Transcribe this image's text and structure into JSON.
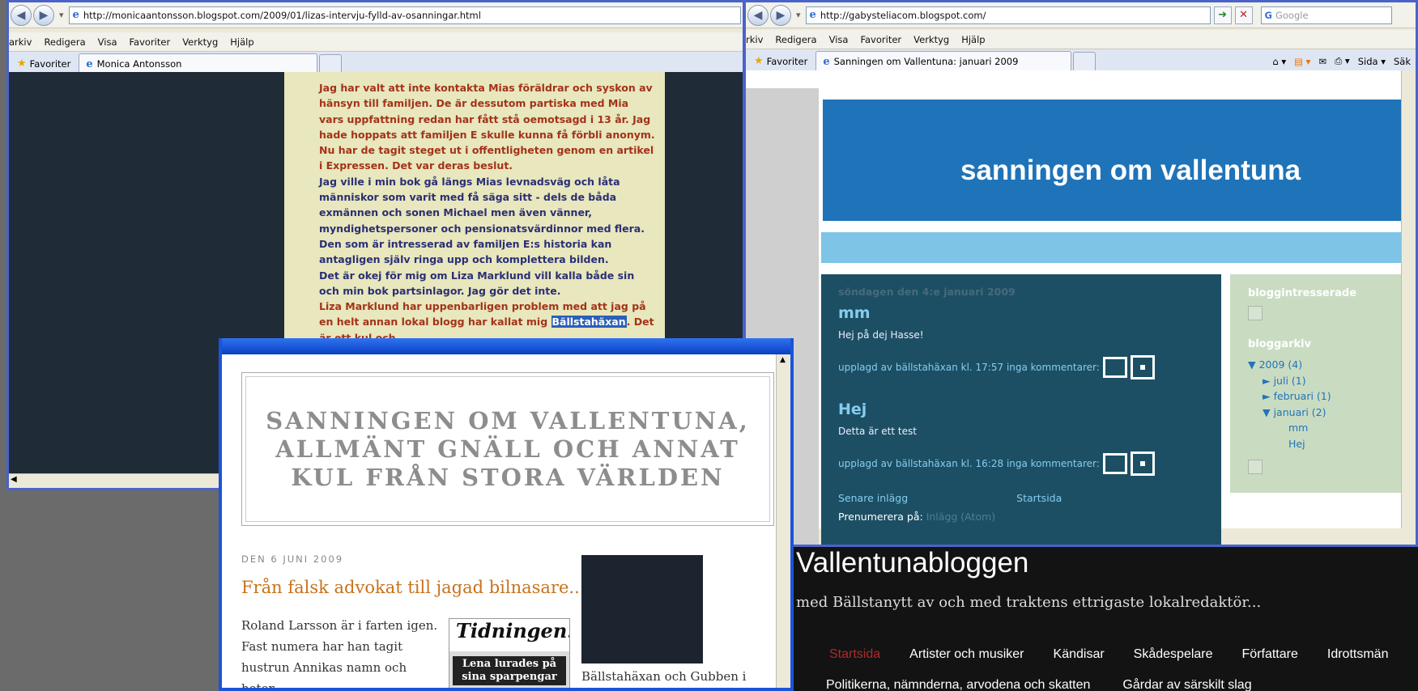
{
  "left_window": {
    "url": "http://monicaantonsson.blogspot.com/2009/01/lizas-intervju-fylld-av-osanningar.html",
    "menu": [
      "arkiv",
      "Redigera",
      "Visa",
      "Favoriter",
      "Verktyg",
      "Hjälp"
    ],
    "favorites_label": "Favoriter",
    "tab_title": "Monica Antonsson",
    "paragraphs": [
      {
        "color": "red",
        "text": "Jag har valt att inte kontakta Mias föräldrar och syskon av hänsyn till familjen. De är dessutom partiska med Mia vars uppfattning redan har fått stå oemotsagd i 13 år. Jag hade hoppats att familjen E skulle kunna få förbli anonym. Nu har de tagit steget ut i offentligheten genom en artikel i Expressen. Det var deras beslut."
      },
      {
        "color": "blue",
        "text": "Jag ville i min bok gå längs Mias levnadsväg och låta människor som varit med få säga sitt - dels de båda exmännen och sonen Michael men även vänner, myndighetspersoner och pensionatsvärdinnor med flera. Den som är intresserad av familjen E:s historia kan antagligen själv ringa upp och komplettera bilden."
      },
      {
        "color": "blue",
        "text": "Det är okej för mig om Liza Marklund vill kalla både sin och min bok partsinlagor. Jag gör det inte."
      }
    ],
    "last_para": {
      "before": "Liza Marklund har uppenbarligen problem med att jag på en helt annan lokal blogg har kallat mig ",
      "highlight": "Bällstahäxan",
      "after": ". Det är ett kul och"
    }
  },
  "right_window": {
    "url": "http://gabysteliacom.blogspot.com/",
    "search_placeholder": "Google",
    "menu": [
      "rkiv",
      "Redigera",
      "Visa",
      "Favoriter",
      "Verktyg",
      "Hjälp"
    ],
    "favorites_label": "Favoriter",
    "tab_title": "Sanningen om Vallentuna: januari 2009",
    "toolbar_page": "Sida",
    "toolbar_extra": "Säk",
    "banner_title": "sanningen om vallentuna",
    "post_date": "söndagen den 4:e januari 2009",
    "posts": [
      {
        "title": "mm",
        "body": "Hej på dej Hasse!",
        "footer": "upplagd av bällstahäxan kl. 17:57 inga kommentarer:"
      },
      {
        "title": "Hej",
        "body": "Detta är ett test",
        "footer": "upplagd av bällstahäxan kl. 16:28 inga kommentarer:"
      }
    ],
    "newer_link": "Senare inlägg",
    "home_link": "Startsida",
    "subscribe_label": "Prenumerera på:",
    "subscribe_link": "Inlägg (Atom)",
    "sidebar": {
      "heading1": "bloggintresserade",
      "heading2": "bloggarkiv",
      "tree": [
        "▼ 2009 (4)",
        "► juli (1)",
        "► februari (1)",
        "▼ januari (2)",
        "mm",
        "Hej"
      ]
    }
  },
  "popup_window": {
    "header": "SANNINGEN OM VALLENTUNA, ALLMÄNT GNÄLL OCH ANNAT KUL FRÅN STORA VÄRLDEN",
    "date": "DEN 6 JUNI 2009",
    "post_title": "Från falsk advokat till jagad bilnasare...",
    "text": "Roland Larsson är i farten igen. Fast numera har han tagit hustrun Annikas namn och heter",
    "paper_masthead": "Tidningen!",
    "paper_headline": "Lena lurades på sina sparpengar",
    "thumb_caption": "Bällstahäxan och Gubben i Hörnan"
  },
  "dark_window": {
    "title": "Vallentunabloggen",
    "subtitle": "med Bällstanytt av och med traktens ettrigaste lokalredaktör...",
    "nav1": [
      "Startsida",
      "Artister och musiker",
      "Kändisar",
      "Skådespelare",
      "Författare",
      "Idrottsmän"
    ],
    "nav2": [
      "Politikerna, nämnderna, arvodena och skatten",
      "Gårdar av särskilt slag"
    ]
  },
  "colors": {
    "accent_blue": "#1f73b8",
    "selection": "#2b5fb8",
    "post_bg": "#1c4f64",
    "link": "#87ccef"
  }
}
